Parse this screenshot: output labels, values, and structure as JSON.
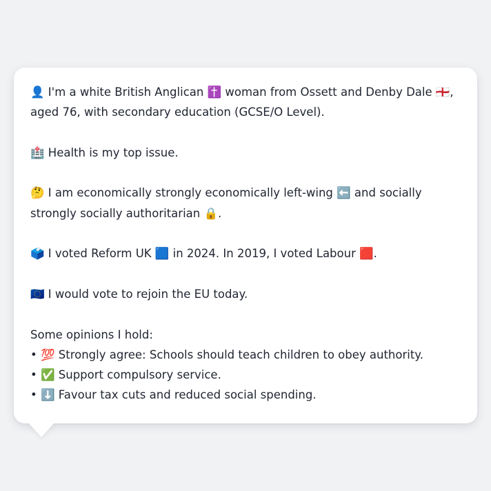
{
  "profile": {
    "identity": "👤 I'm a white British Anglican ✝️ woman from Ossett and Denby Dale 🏴󠁧󠁢󠁥󠁮󠁧󠁿, aged 76, with secondary education (GCSE/O Level).",
    "top_issue": "🏥 Health is my top issue.",
    "ideology": "🤔 I am economically strongly economically left-wing ⬅️ and socially strongly socially authoritarian 🔒.",
    "votes": "🗳️ I voted Reform UK 🟦 in 2024. In 2019, I voted Labour 🟥.",
    "eu": "🇪🇺 I would vote to rejoin the EU today.",
    "opinions_heading": "Some opinions I hold:",
    "opinions": [
      "• 💯 Strongly agree: Schools should teach children to obey authority.",
      "• ✅ Support compulsory service.",
      "• ⬇️ Favour tax cuts and reduced social spending."
    ]
  }
}
